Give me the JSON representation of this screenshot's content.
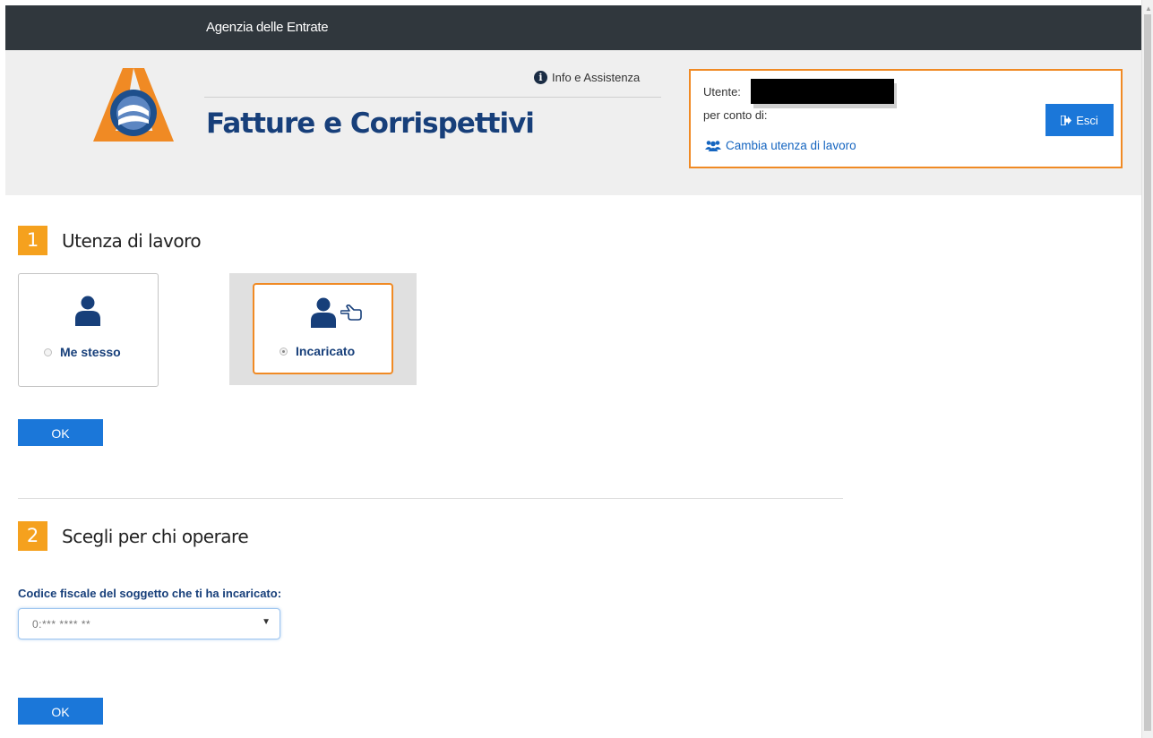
{
  "topbar": {
    "title": "Agenzia delle Entrate"
  },
  "header": {
    "app_title": "Fatture e Corrispettivi",
    "info_link": "Info e Assistenza",
    "user": {
      "utente_label": "Utente:",
      "per_conto_label": "per conto di:",
      "change_link": "Cambia utenza di lavoro",
      "exit_label": "Esci"
    }
  },
  "step1": {
    "number": "1",
    "title": "Utenza di lavoro",
    "options": [
      {
        "label": "Me stesso",
        "selected": false
      },
      {
        "label": "Incaricato",
        "selected": true
      }
    ],
    "ok_label": "OK"
  },
  "step2": {
    "number": "2",
    "title": "Scegli per chi operare",
    "field_label": "Codice fiscale del soggetto che ti ha incaricato:",
    "select_value": "0:*** **** **",
    "ok_label": "OK"
  },
  "colors": {
    "accent": "#f08a24",
    "primary": "#1b77d9",
    "title": "#173f7a",
    "topbar": "#30373d"
  },
  "icons": [
    "info-icon",
    "users-icon",
    "exit-icon",
    "user-icon",
    "hand-pointer-icon",
    "chevron-down-icon"
  ]
}
